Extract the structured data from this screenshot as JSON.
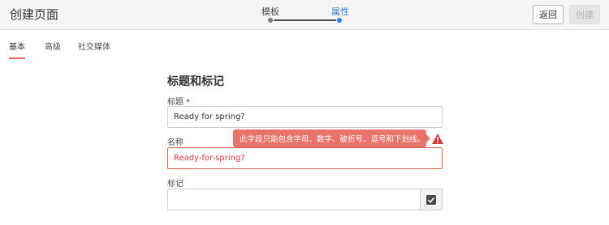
{
  "header": {
    "title": "创建页面",
    "back_label": "返回",
    "create_label": "创建"
  },
  "wizard": {
    "steps": [
      {
        "label": "模板",
        "state": "completed"
      },
      {
        "label": "属性",
        "state": "current"
      }
    ],
    "accent": "#2680eb"
  },
  "tabs": [
    {
      "label": "基本",
      "active": true
    },
    {
      "label": "高级",
      "active": false
    },
    {
      "label": "社交媒体",
      "active": false
    }
  ],
  "form": {
    "section_title": "标题和标记",
    "title_field": {
      "label": "标题 *",
      "value": "Ready for spring?"
    },
    "name_field": {
      "label": "名称",
      "value": "Ready-for-spring?",
      "invalid": true
    },
    "tags_field": {
      "label": "标记",
      "value": "",
      "picker_icon": "checkbox-list-icon"
    },
    "error": {
      "message": "此字段只能包含字母、数字、破折号、逗号和下划线。",
      "icon": "alert-icon",
      "color": "#e8736a"
    }
  }
}
